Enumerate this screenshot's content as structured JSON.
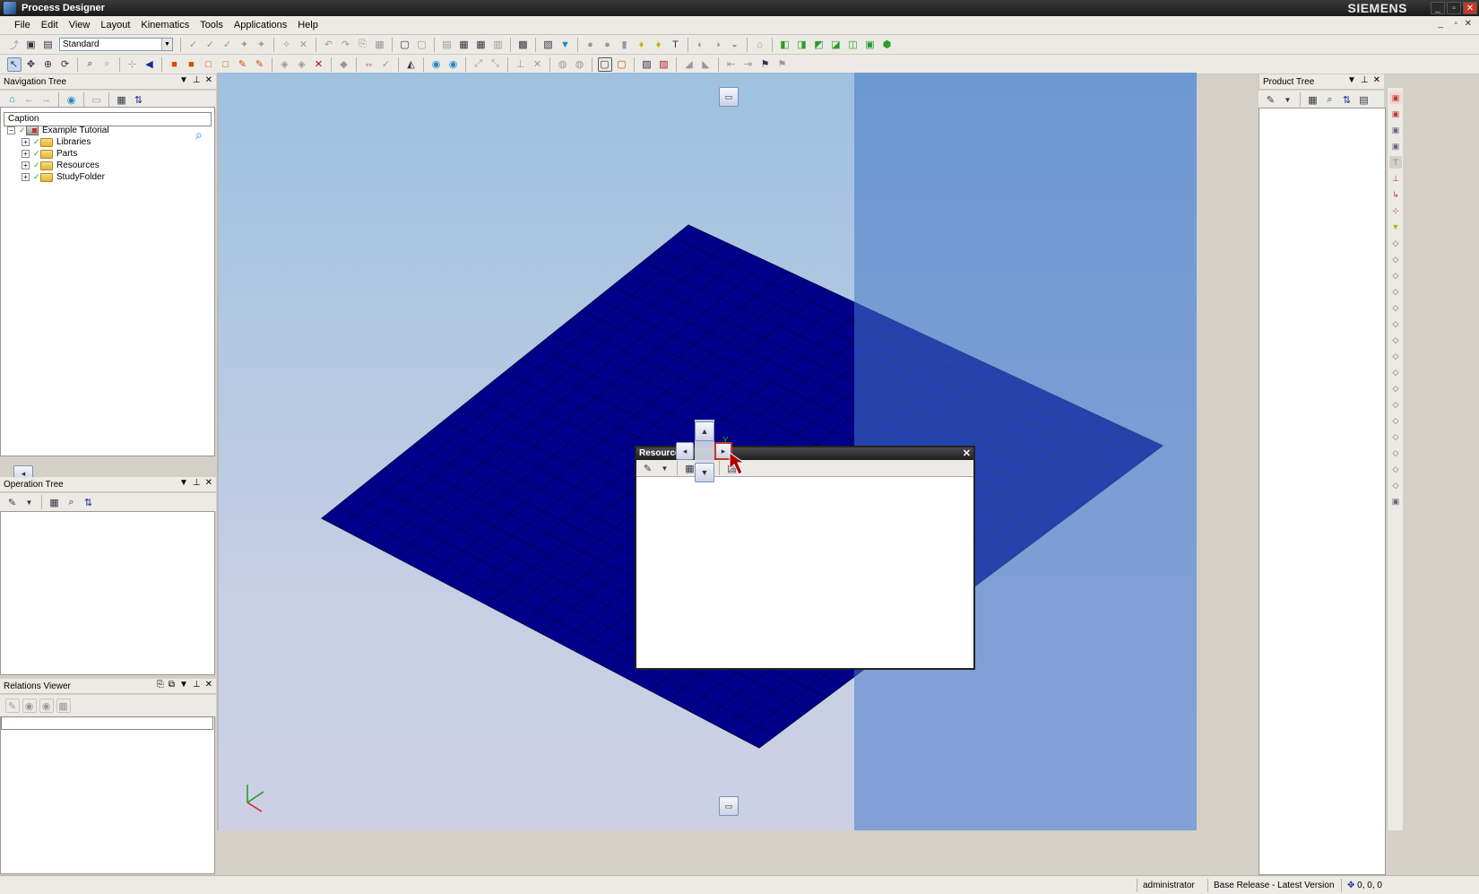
{
  "window": {
    "title": "Process Designer",
    "brand": "SIEMENS"
  },
  "menu": [
    "File",
    "Edit",
    "View",
    "Layout",
    "Kinematics",
    "Tools",
    "Applications",
    "Help"
  ],
  "toolbar": {
    "layout_combo": "Standard"
  },
  "navigation_tree": {
    "title": "Navigation Tree",
    "caption_header": "Caption",
    "root": "Example Tutorial",
    "items": [
      "Libraries",
      "Parts",
      "Resources",
      "StudyFolder"
    ]
  },
  "operation_tree": {
    "title": "Operation Tree"
  },
  "relations_viewer": {
    "title": "Relations Viewer"
  },
  "product_tree": {
    "title": "Product Tree"
  },
  "floating_window": {
    "title": "Resource"
  },
  "viewport": {
    "axis_label": "Y",
    "plane_color": "#00008a"
  },
  "status": {
    "user": "administrator",
    "release": "Base Release - Latest Version",
    "coords": "0, 0, 0"
  }
}
